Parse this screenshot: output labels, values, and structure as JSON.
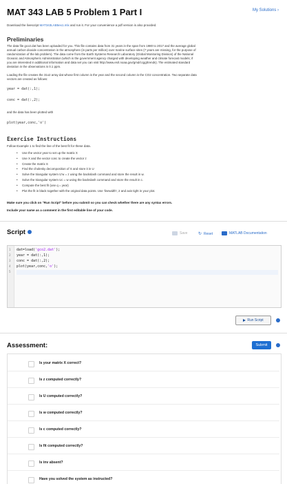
{
  "header": {
    "title": "MAT 343 LAB 5 Problem 1 Part I",
    "my_solutions": "My Solutions ›",
    "download_text_pre": "Download the livescript",
    "download_link": "MAT343LAB5ex1.mlx",
    "download_text_post": "and run it. For your convenience a pdf version is also provided."
  },
  "prelim": {
    "heading": "Preliminaries",
    "para1": [
      "The data file gco2.dat has been uploaded for you. This file contains data from 31 years in the span from 1980 to 2017 and the average global",
      "annual carbon dioxide concentration in the atmosphere (in parts per million) over marine surface sites (7 years are missing, for the purpose of",
      "randomization of the lab problem). The data come from the Earth Systems Research Laboratory (Global Monitoring Division) of the National",
      "Oceanic and Atmospheric Administration (which is the government agency charged with developing weather and climate forecast models; if",
      "you are interested in additional information and data set you can visit http://www.esrl.noaa.gov/gmd/ccgg/trends). The estimated standard",
      "deviation in the observations is 0.1 ppm."
    ],
    "para2": [
      "Loading the file creates the 31x2 array dat whose first column is the year and the second column is the CO2 concentration. Two separate data",
      "vectors are created as follows:"
    ],
    "code1": "year = dat(:,1);",
    "code2": "conc = dat(:,2);",
    "plotted_text": "and the data has been plotted with",
    "code3": "plot(year,conc,'o')"
  },
  "exercise": {
    "heading": "Exercise Instructions",
    "follow": "Follow Example 1 to find the line of the best fit for these data.",
    "steps": [
      "Use the vector year to set up the matrix X",
      "Use X and the vector conc to create the vector z",
      "Create the matrix S",
      "Find the cholesky decomposition of S and store it in U",
      "Solve the triangular system U'w = z using the backslash command and store the result in w.",
      "Solve the triangular system Uc = w using the backslash command and store the result in c.",
      "Compute the best fit (use q = year)",
      "Plot the fit in black together with the original data points. Use 'linewidth', 2 and axis tight in your plot."
    ],
    "warn1": "Make sure you click on \"Run Script\" before you submit so you can check whether there are any syntax errors.",
    "warn2": "Include your name as a comment in the first editable line of your code."
  },
  "script": {
    "heading": "Script",
    "save_label": "Save",
    "reset_label": "Reset",
    "doc_label": "MATLAB Documentation",
    "lines": [
      {
        "num": "1",
        "pre": "dat=load(",
        "str": "'gco2.dat'",
        "post": ");"
      },
      {
        "num": "2",
        "pre": "year = dat(:,1);",
        "str": "",
        "post": ""
      },
      {
        "num": "3",
        "pre": "conc = dat(:,2);",
        "str": "",
        "post": ""
      },
      {
        "num": "4",
        "pre": "plot(year,conc,",
        "str": "'o'",
        "post": ");"
      },
      {
        "num": "5",
        "pre": "",
        "str": "",
        "post": ""
      }
    ],
    "run_label": "Run Script"
  },
  "assessment": {
    "heading": "Assessment:",
    "submit_label": "Submit",
    "questions": [
      "Is your matrix X correct?",
      "Is z computed correctly?",
      "Is U computed correctly?",
      "Is w computed correctly?",
      "Is c computed correctly?",
      "Is fit computed correctly?",
      "Is inv absent?",
      "Have you solved the system as instructed?"
    ]
  }
}
